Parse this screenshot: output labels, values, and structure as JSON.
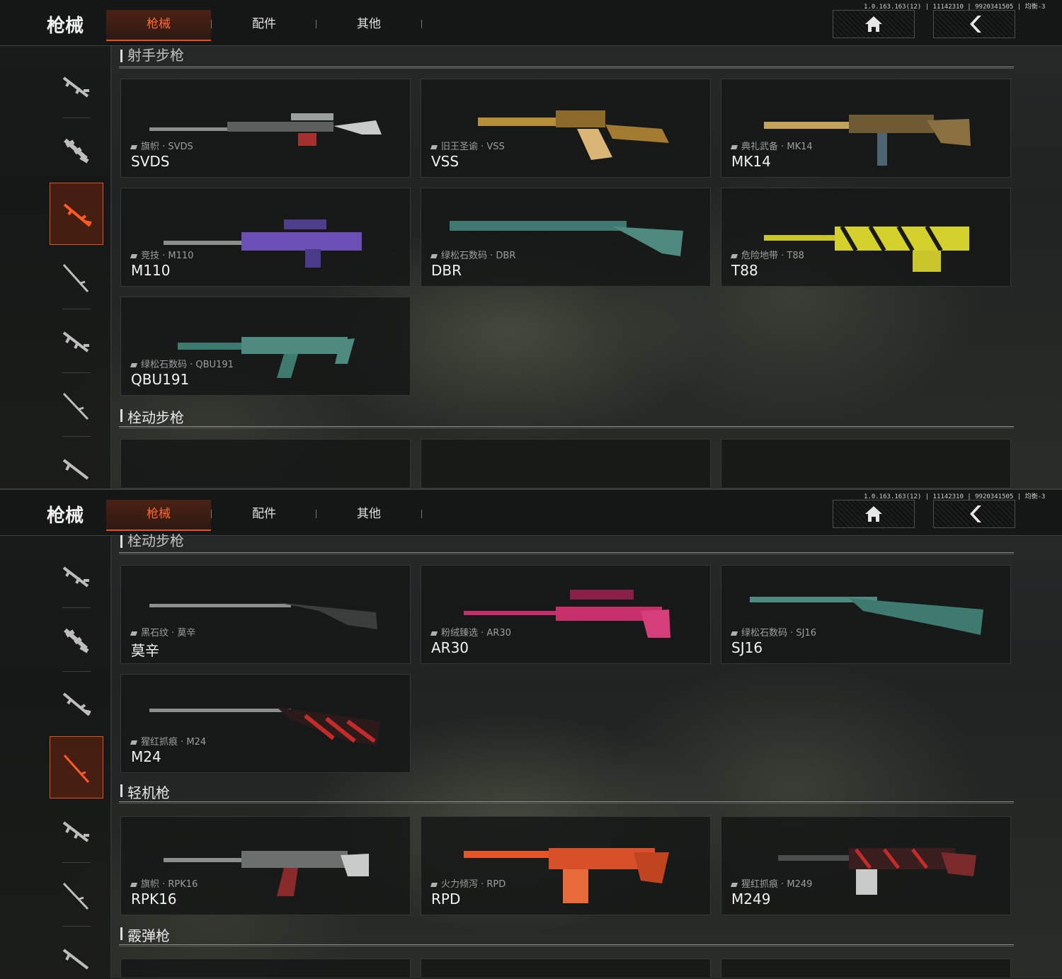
{
  "app_title": "枪械",
  "tabs": [
    "枪械",
    "配件",
    "其他"
  ],
  "version": "1.0.163.163(12) | 11142310 | 9920341505 | 均衡-3",
  "screens": [
    {
      "sections": [
        {
          "title": "射手步枪"
        },
        {
          "title": "栓动步枪"
        }
      ],
      "cards": [
        {
          "skin": "旗帜 · SVDS",
          "name": "SVDS"
        },
        {
          "skin": "旧王圣谕 · VSS",
          "name": "VSS"
        },
        {
          "skin": "典礼武备 · MK14",
          "name": "MK14"
        },
        {
          "skin": "竞技 · M110",
          "name": "M110"
        },
        {
          "skin": "绿松石数码 · DBR",
          "name": "DBR"
        },
        {
          "skin": "危险地带 · T88",
          "name": "T88"
        },
        {
          "skin": "绿松石数码 · QBU191",
          "name": "QBU191"
        }
      ]
    },
    {
      "sections": [
        {
          "title": "栓动步枪"
        },
        {
          "title": "轻机枪"
        },
        {
          "title": "霰弹枪"
        }
      ],
      "cards": [
        {
          "skin": "黑石纹 · 莫辛",
          "name": "莫辛"
        },
        {
          "skin": "粉绒臻选 · AR30",
          "name": "AR30"
        },
        {
          "skin": "绿松石数码 · SJ16",
          "name": "SJ16"
        },
        {
          "skin": "猩红抓痕 · M24",
          "name": "M24"
        },
        {
          "skin": "旗帜 · RPK16",
          "name": "RPK16"
        },
        {
          "skin": "火力倾泻 · RPD",
          "name": "RPD"
        },
        {
          "skin": "猩红抓痕 · M249",
          "name": "M249"
        }
      ]
    }
  ],
  "icons": {
    "home": "home-icon",
    "back": "back-arrow-icon",
    "categories": [
      "assault-rifle-icon",
      "smg-icon",
      "marksman-rifle-icon",
      "sniper-rifle-icon",
      "lmg-icon",
      "shotgun-icon"
    ]
  },
  "colors": {
    "accent": "#e0521f",
    "card_bg": "#161817"
  }
}
